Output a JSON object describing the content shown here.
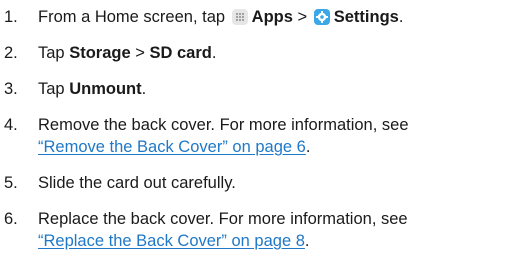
{
  "steps": [
    {
      "number": "1.",
      "intro": "From a Home screen, tap",
      "apps_icon": "apps-grid-icon",
      "apps_label": "Apps",
      "separator": ">",
      "settings_icon": "settings-gear-icon",
      "settings_label": "Settings",
      "end": "."
    },
    {
      "number": "2.",
      "intro": "Tap",
      "storage_label": "Storage",
      "separator": ">",
      "sdcard_label": "SD card",
      "end": "."
    },
    {
      "number": "3.",
      "intro": "Tap",
      "unmount_label": "Unmount",
      "end": "."
    },
    {
      "number": "4.",
      "line1": "Remove the back cover. For more information, see",
      "link": "“Remove the Back Cover” on page 6",
      "end": "."
    },
    {
      "number": "5.",
      "line1": "Slide the card out carefully."
    },
    {
      "number": "6.",
      "line1": "Replace the back cover. For more information, see",
      "link": "“Replace the Back Cover” on page 8",
      "end": "."
    }
  ],
  "colors": {
    "link": "#1f78c8",
    "settings_icon_bg": "#3aa7e8",
    "apps_icon_bg": "#e6e6e6"
  }
}
